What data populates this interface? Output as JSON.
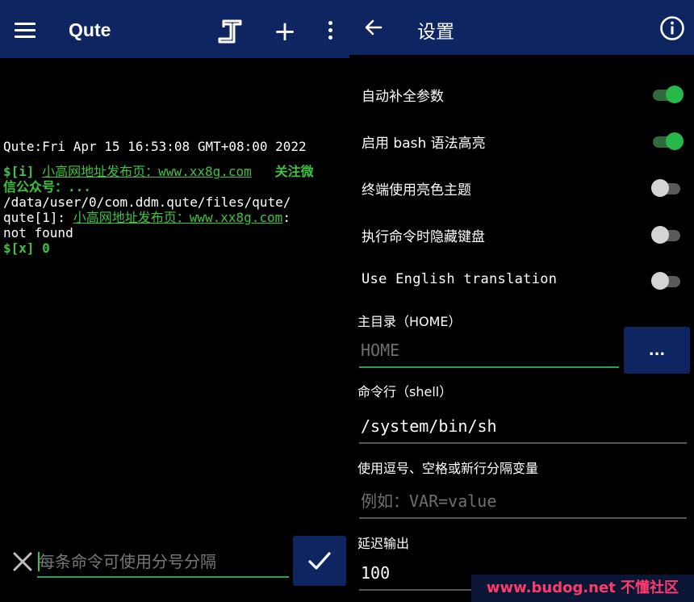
{
  "left_panel": {
    "app_title": "Qute",
    "icons": {
      "menu": "menu-icon",
      "tab_switch": "tab-switch-icon",
      "new_tab": "plus-icon",
      "more": "more-vert-icon"
    },
    "plus_glyph": "+",
    "terminal": {
      "line1": "Qute:Fri Apr 15 16:53:08 GMT+08:00 2022",
      "prompt1": "$[i] ",
      "link1": "小高网地址发布页：www.xx8g.com",
      "follow_text": "   关注微",
      "follow_text2": "信公众号：...",
      "path_line": "/data/user/0/com.ddm.qute/files/qute/",
      "error_prefix": "qute[1]: ",
      "link2": "小高网地址发布页：www.xx8g.com",
      "error_colon": ":",
      "not_found": "not found",
      "exit_line": "$[x] 0"
    },
    "command_input": {
      "placeholder": "每条命令可使用分号分隔",
      "value": ""
    }
  },
  "right_panel": {
    "title": "设置",
    "icons": {
      "back": "arrow-left-icon",
      "info": "info-icon",
      "submit": "check-icon",
      "clear": "close-icon"
    },
    "toggles": [
      {
        "label": "自动补全参数",
        "on": true
      },
      {
        "label": "启用 bash 语法高亮",
        "on": true
      },
      {
        "label": "终端使用亮色主题",
        "on": false
      },
      {
        "label": "执行命令时隐藏键盘",
        "on": false
      },
      {
        "label": "Use English translation",
        "on": false
      }
    ],
    "home": {
      "label": "主目录（HOME）",
      "placeholder": "HOME",
      "value": "",
      "browse_label": "..."
    },
    "shell": {
      "label": "命令行（shell）",
      "value": "/system/bin/sh"
    },
    "env": {
      "label": "使用逗号、空格或新行分隔变量",
      "placeholder": "例如：VAR=value",
      "value": ""
    },
    "delay": {
      "label": "延迟输出",
      "value": "100"
    }
  },
  "watermark": "www.budog.net 不懂社区",
  "colors": {
    "appbar": "#0f2561",
    "accent_green": "#27b84b",
    "terminal_green": "#3ec43e",
    "watermark_red": "#ff3b6b"
  }
}
